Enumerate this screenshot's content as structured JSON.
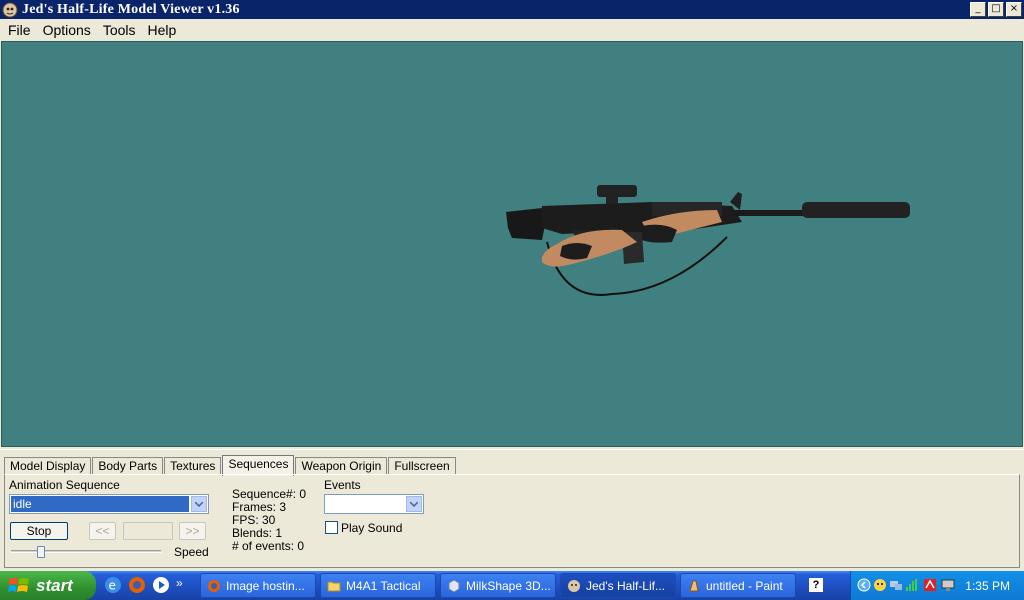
{
  "window": {
    "title": "Jed's Half-Life Model Viewer v1.36",
    "controls": {
      "minimize": "_",
      "maximize": "□",
      "close": "×"
    }
  },
  "menu": [
    "File",
    "Options",
    "Tools",
    "Help"
  ],
  "tabs": [
    "Model Display",
    "Body Parts",
    "Textures",
    "Sequences",
    "Weapon Origin",
    "Fullscreen"
  ],
  "active_tab": "Sequences",
  "sequences": {
    "animation_label": "Animation Sequence",
    "animation_value": "idle",
    "stop_label": "Stop",
    "prev_label": "<<",
    "next_label": ">>",
    "speed_label": "Speed",
    "speed_level": 0.2,
    "info": {
      "sequence": "Sequence#: 0",
      "frames": "Frames: 3",
      "fps": "FPS: 30",
      "blends": "Blends: 1",
      "events_count": "# of events: 0"
    },
    "events_label": "Events",
    "events_value": "",
    "play_sound_label": "Play Sound",
    "play_sound_checked": false
  },
  "colors": {
    "viewport_bg": "#408080",
    "titlebar": "#0a246a",
    "selection": "#316ac5"
  },
  "taskbar": {
    "start_label": "start",
    "tasks": [
      {
        "label": "Image hostin...",
        "icon": "firefox-icon"
      },
      {
        "label": "M4A1 Tactical",
        "icon": "folder-icon"
      },
      {
        "label": "MilkShape 3D...",
        "icon": "milkshape-icon"
      },
      {
        "label": "Jed's Half-Lif...",
        "icon": "hlmv-icon",
        "active": true
      },
      {
        "label": "untitled - Paint",
        "icon": "paint-icon"
      }
    ],
    "more": "»",
    "help_icon_label": "?",
    "clock": "1:35 PM"
  }
}
